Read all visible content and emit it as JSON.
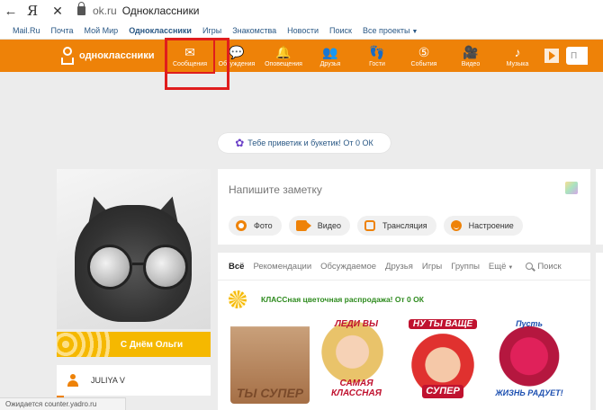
{
  "browser": {
    "back_glyph": "←",
    "yandex_glyph": "Я",
    "close_glyph": "✕",
    "host": "ok.ru",
    "page_title": "Одноклассники"
  },
  "portal_links": [
    {
      "label": "Mail.Ru",
      "active": false
    },
    {
      "label": "Почта",
      "active": false
    },
    {
      "label": "Мой Мир",
      "active": false
    },
    {
      "label": "Одноклассники",
      "active": true
    },
    {
      "label": "Игры",
      "active": false
    },
    {
      "label": "Знакомства",
      "active": false
    },
    {
      "label": "Новости",
      "active": false
    },
    {
      "label": "Поиск",
      "active": false
    },
    {
      "label": "Все проекты",
      "active": false
    }
  ],
  "toolbar": {
    "logo_text": "одноклассники",
    "items": [
      {
        "label": "Сообщения",
        "icon": "envelope-icon",
        "glyph": "✉",
        "highlighted": true
      },
      {
        "label": "Обсуждения",
        "icon": "chat-icon",
        "glyph": "💬",
        "highlighted": false
      },
      {
        "label": "Оповещения",
        "icon": "bell-icon",
        "glyph": "🔔",
        "highlighted": false
      },
      {
        "label": "Друзья",
        "icon": "friends-icon",
        "glyph": "👥",
        "highlighted": false
      },
      {
        "label": "Гости",
        "icon": "footprints-icon",
        "glyph": "👣",
        "highlighted": false
      },
      {
        "label": "События",
        "icon": "events-icon",
        "glyph": "⑤",
        "highlighted": false
      },
      {
        "label": "Видео",
        "icon": "video-camera-icon",
        "glyph": "🎥",
        "highlighted": false
      },
      {
        "label": "Музыка",
        "icon": "music-note-icon",
        "glyph": "♪",
        "highlighted": false
      }
    ],
    "search_stub": "П"
  },
  "notice": {
    "text": "Тебе приветик и букетик! От 0 ОК"
  },
  "profile": {
    "congrats": "С Днём Ольги",
    "user_name": "JULIYA V"
  },
  "note": {
    "placeholder": "Напишите заметку",
    "actions": [
      "Фото",
      "Видео",
      "Трансляция",
      "Настроение"
    ]
  },
  "feed": {
    "tabs": [
      "Всё",
      "Рекомендации",
      "Обсуждаемое",
      "Друзья",
      "Игры",
      "Группы",
      "Ещё"
    ],
    "search_label": "Поиск",
    "post_title": "КЛАССная цветочная распродажа! От 0 ОК",
    "stickers": [
      {
        "top": "",
        "caption": "ТЫ СУПЕР"
      },
      {
        "top": "ЛЕДИ ВЫ",
        "caption": "САМАЯ КЛАССНАЯ"
      },
      {
        "top": "НУ ТЫ ВАЩЕ",
        "caption": "СУПЕР"
      },
      {
        "top": "Пусть",
        "caption": "ЖИЗНЬ РАДУЕТ!"
      }
    ]
  },
  "status_bar": "Ожидается counter.yadro.ru",
  "colors": {
    "accent": "#ee8208",
    "highlight": "#e01d1d",
    "link": "#2a5885"
  }
}
